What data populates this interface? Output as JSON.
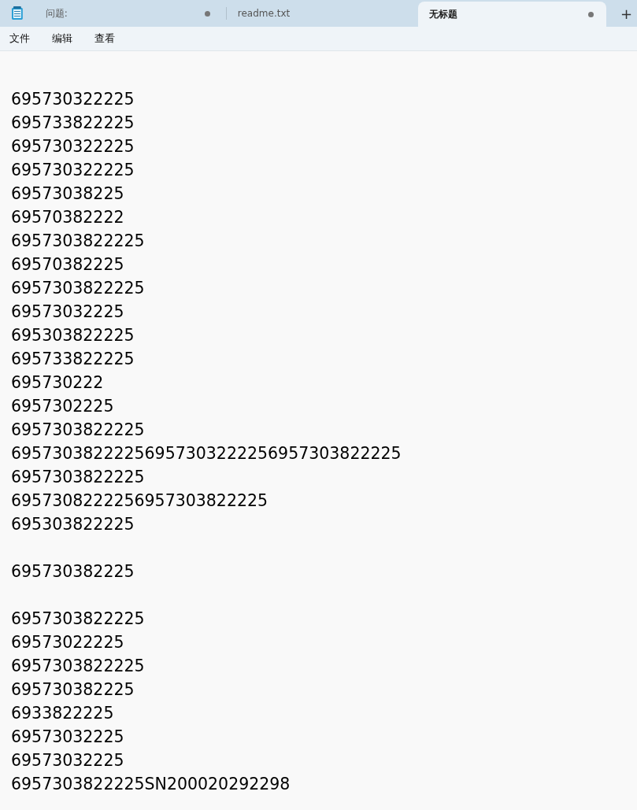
{
  "tabs": [
    {
      "label": "问题:",
      "selected": false,
      "modified": true
    },
    {
      "label": "readme.txt",
      "selected": false,
      "modified": false
    },
    {
      "label": "无标题",
      "selected": true,
      "modified": true
    }
  ],
  "new_tab": "+",
  "menu": [
    "文件",
    "编辑",
    "查看"
  ],
  "blocks": [
    [
      "695730322225",
      "695733822225",
      "695730322225",
      "695730322225",
      "69573038225",
      "69570382222",
      "6957303822225",
      "69570382225",
      "6957303822225",
      "69573032225",
      "695303822225",
      "695733822225",
      "695730222",
      "6957302225",
      "6957303822225",
      "69573038222256957303222256957303822225",
      "6957303822225",
      "6957308222256957303822225",
      "695303822225"
    ],
    [
      "695730382225"
    ],
    [
      "6957303822225",
      "69573022225",
      "6957303822225",
      "695730382225",
      "6933822225",
      "69573032225",
      "69573032225",
      "6957303822225SN200020292298"
    ]
  ]
}
